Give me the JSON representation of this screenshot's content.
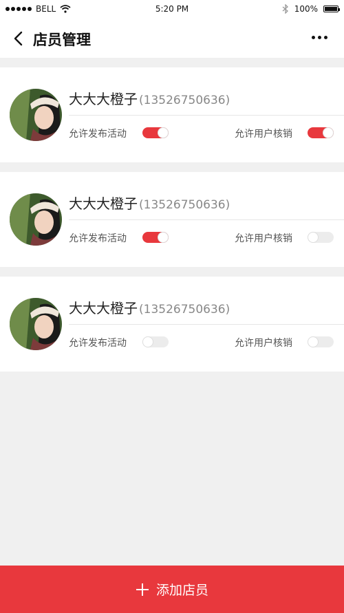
{
  "status_bar": {
    "carrier": "BELL",
    "time": "5:20 PM",
    "battery": "100%",
    "icons": [
      "signal-dots-icon",
      "wifi-icon",
      "bluetooth-icon",
      "battery-icon"
    ]
  },
  "nav": {
    "title": "店员管理",
    "back_icon": "chevron-left-icon",
    "more_icon": "more-dots-icon"
  },
  "staff": [
    {
      "name": "大大大橙子",
      "phone": "(13526750636)",
      "perm1_label": "允许发布活动",
      "perm1_on": true,
      "perm2_label": "允许用户核销",
      "perm2_on": true
    },
    {
      "name": "大大大橙子",
      "phone": "(13526750636)",
      "perm1_label": "允许发布活动",
      "perm1_on": true,
      "perm2_label": "允许用户核销",
      "perm2_on": false
    },
    {
      "name": "大大大橙子",
      "phone": "(13526750636)",
      "perm1_label": "允许发布活动",
      "perm1_on": false,
      "perm2_label": "允许用户核销",
      "perm2_on": false
    }
  ],
  "add_button": {
    "label": "添加店员",
    "icon": "plus-icon"
  },
  "colors": {
    "accent": "#e8383d",
    "background": "#f0f0f0"
  }
}
